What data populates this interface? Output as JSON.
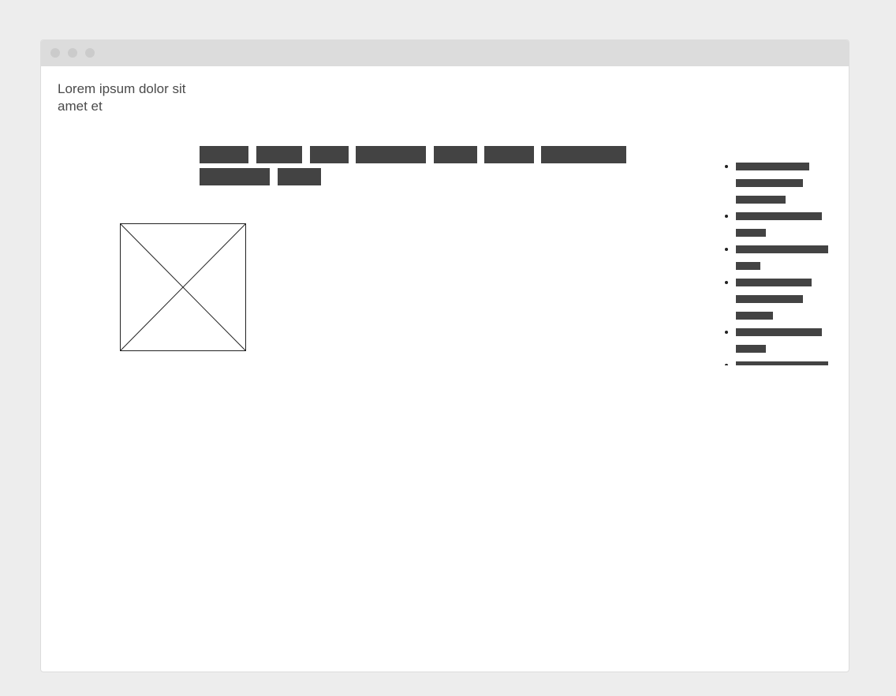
{
  "window": {
    "controls": [
      "close",
      "minimize",
      "maximize"
    ]
  },
  "header": {
    "logo_text": "Lorem ipsum dolor sit amet et"
  },
  "nav": {
    "item_count": 9,
    "item_style": "placeholder-bar"
  },
  "main": {
    "image_placeholder": "image-placeholder-icon"
  },
  "sidebar": {
    "list_items": 6,
    "item_style": "placeholder-bar"
  },
  "colors": {
    "background": "#ededed",
    "titlebar": "#dcdcdc",
    "placeholder_bar": "#434343",
    "text": "#4a4a4a"
  }
}
